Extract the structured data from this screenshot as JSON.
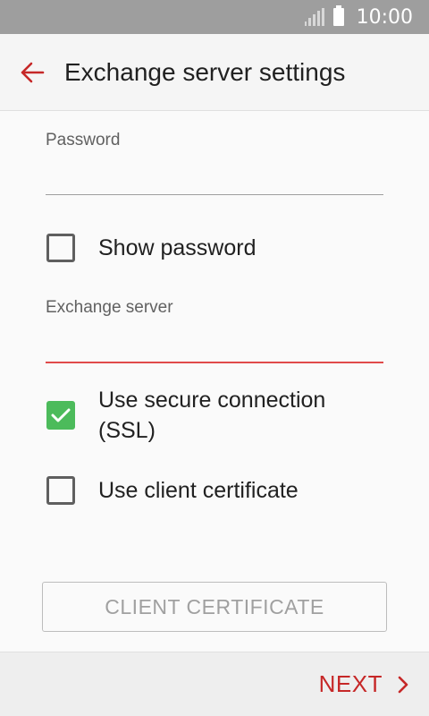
{
  "status_bar": {
    "time": "10:00"
  },
  "app_bar": {
    "title": "Exchange server settings"
  },
  "form": {
    "password": {
      "label": "Password",
      "value": ""
    },
    "show_password": {
      "label": "Show password",
      "checked": false
    },
    "exchange_server": {
      "label": "Exchange server",
      "value": ""
    },
    "secure_connection": {
      "label_line1": "Use secure connection",
      "label_line2": "(SSL)",
      "checked": true
    },
    "client_certificate": {
      "label": "Use client certificate",
      "checked": false
    },
    "cert_button": {
      "label": "CLIENT CERTIFICATE"
    }
  },
  "bottom_bar": {
    "next_label": "NEXT"
  },
  "colors": {
    "accent": "#c62828",
    "check": "#4cbb5b",
    "status_bar": "#9e9e9e"
  }
}
